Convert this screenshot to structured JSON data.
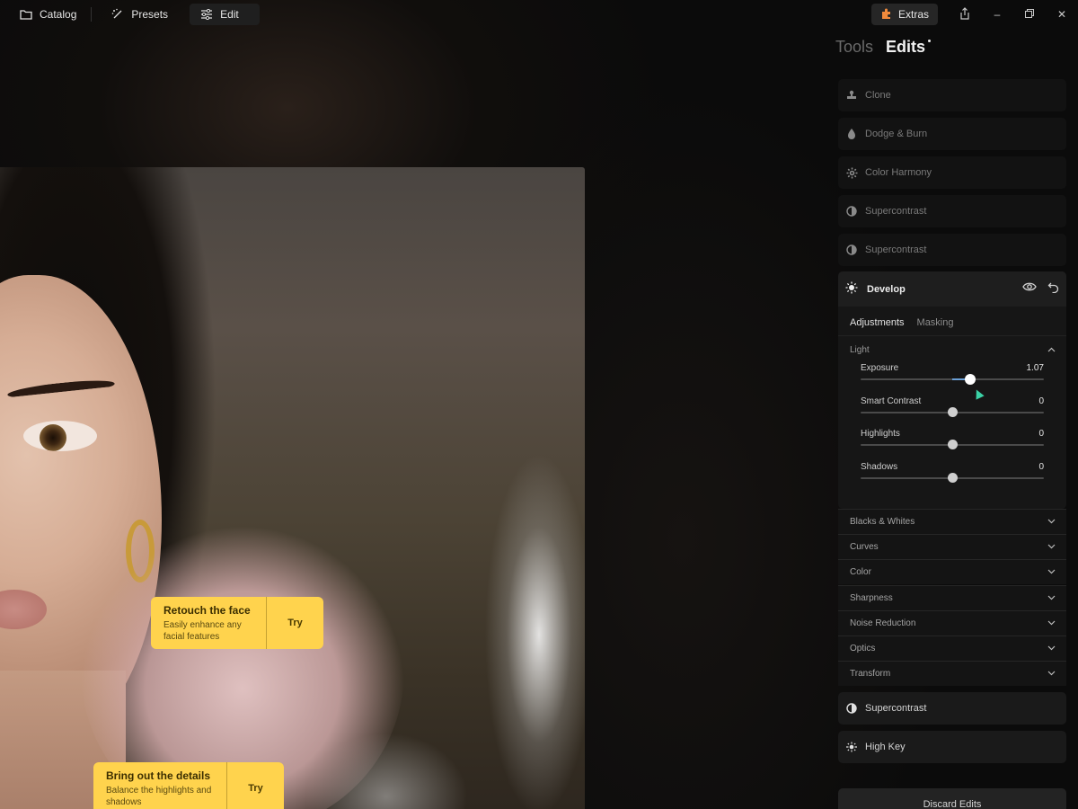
{
  "nav": {
    "catalog": "Catalog",
    "presets": "Presets",
    "edit": "Edit"
  },
  "extras_label": "Extras",
  "colors": {
    "accent_yellow": "#ffd34d",
    "slider_fill": "#6a9fd6",
    "cursor": "#3bd2a6",
    "panel_bg": "#161616"
  },
  "panel": {
    "tab_tools": "Tools",
    "tab_edits": "Edits",
    "tools": [
      {
        "label": "Clone",
        "icon": "stamp-icon"
      },
      {
        "label": "Dodge & Burn",
        "icon": "drop-icon"
      },
      {
        "label": "Color Harmony",
        "icon": "gear-icon"
      },
      {
        "label": "Supercontrast",
        "icon": "half-circle-icon"
      },
      {
        "label": "Supercontrast",
        "icon": "half-circle-icon"
      }
    ],
    "develop": {
      "title": "Develop",
      "tab_adjustments": "Adjustments",
      "tab_masking": "Masking",
      "group_light": "Light",
      "sliders": [
        {
          "label": "Exposure",
          "value": "1.07",
          "position": 0.6
        },
        {
          "label": "Smart Contrast",
          "value": "0",
          "position": 0.5
        },
        {
          "label": "Highlights",
          "value": "0",
          "position": 0.5
        },
        {
          "label": "Shadows",
          "value": "0",
          "position": 0.5
        }
      ]
    },
    "sections": [
      "Blacks & Whites",
      "Curves",
      "Color",
      "Sharpness",
      "Noise Reduction",
      "Optics",
      "Transform"
    ],
    "bottom_tools": [
      {
        "label": "Supercontrast",
        "icon": "half-circle-icon"
      },
      {
        "label": "High Key",
        "icon": "sun-burst-icon"
      }
    ],
    "discard": "Discard Edits"
  },
  "promos": [
    {
      "title": "Retouch the face",
      "desc": "Easily enhance any facial features",
      "cta": "Try"
    },
    {
      "title": "Bring out the details",
      "desc": "Balance the highlights and shadows",
      "cta": "Try"
    }
  ]
}
